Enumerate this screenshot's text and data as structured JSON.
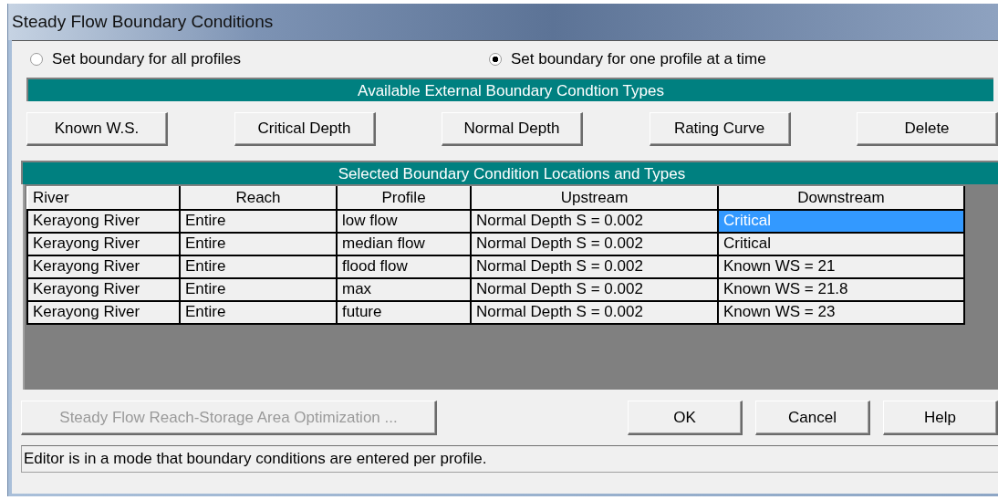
{
  "window": {
    "title": "Steady Flow Boundary Conditions"
  },
  "mode_options": [
    {
      "label": "Set boundary for all profiles",
      "selected": false
    },
    {
      "label": "Set boundary for one profile at a time",
      "selected": true
    }
  ],
  "types_header": "Available External Boundary Condtion Types",
  "type_buttons": [
    {
      "label": "Known W.S."
    },
    {
      "label": "Critical Depth"
    },
    {
      "label": "Normal Depth"
    },
    {
      "label": "Rating Curve"
    },
    {
      "label": "Delete"
    }
  ],
  "locations_header": "Selected Boundary Condition Locations and Types",
  "table": {
    "columns": [
      "River",
      "Reach",
      "Profile",
      "Upstream",
      "Downstream"
    ],
    "rows": [
      {
        "river": "Kerayong River",
        "reach": "Entire",
        "profile": "low flow",
        "upstream": "Normal Depth S = 0.002",
        "downstream": "Critical",
        "selected": true
      },
      {
        "river": "Kerayong River",
        "reach": "Entire",
        "profile": "median flow",
        "upstream": "Normal Depth S = 0.002",
        "downstream": "Critical",
        "selected": false
      },
      {
        "river": "Kerayong River",
        "reach": "Entire",
        "profile": "flood flow",
        "upstream": "Normal Depth S = 0.002",
        "downstream": "Known WS = 21",
        "selected": false
      },
      {
        "river": "Kerayong River",
        "reach": "Entire",
        "profile": "max",
        "upstream": "Normal Depth S = 0.002",
        "downstream": "Known WS = 21.8",
        "selected": false
      },
      {
        "river": "Kerayong River",
        "reach": "Entire",
        "profile": "future",
        "upstream": "Normal Depth S = 0.002",
        "downstream": "Known WS = 23",
        "selected": false
      }
    ]
  },
  "optimization_button": {
    "label": "Steady Flow Reach-Storage Area Optimization ...",
    "disabled": true
  },
  "dialog_buttons": [
    {
      "label": "OK"
    },
    {
      "label": "Cancel"
    },
    {
      "label": "Help"
    }
  ],
  "status_bar": "Editor is in a mode that boundary conditions are entered per profile."
}
